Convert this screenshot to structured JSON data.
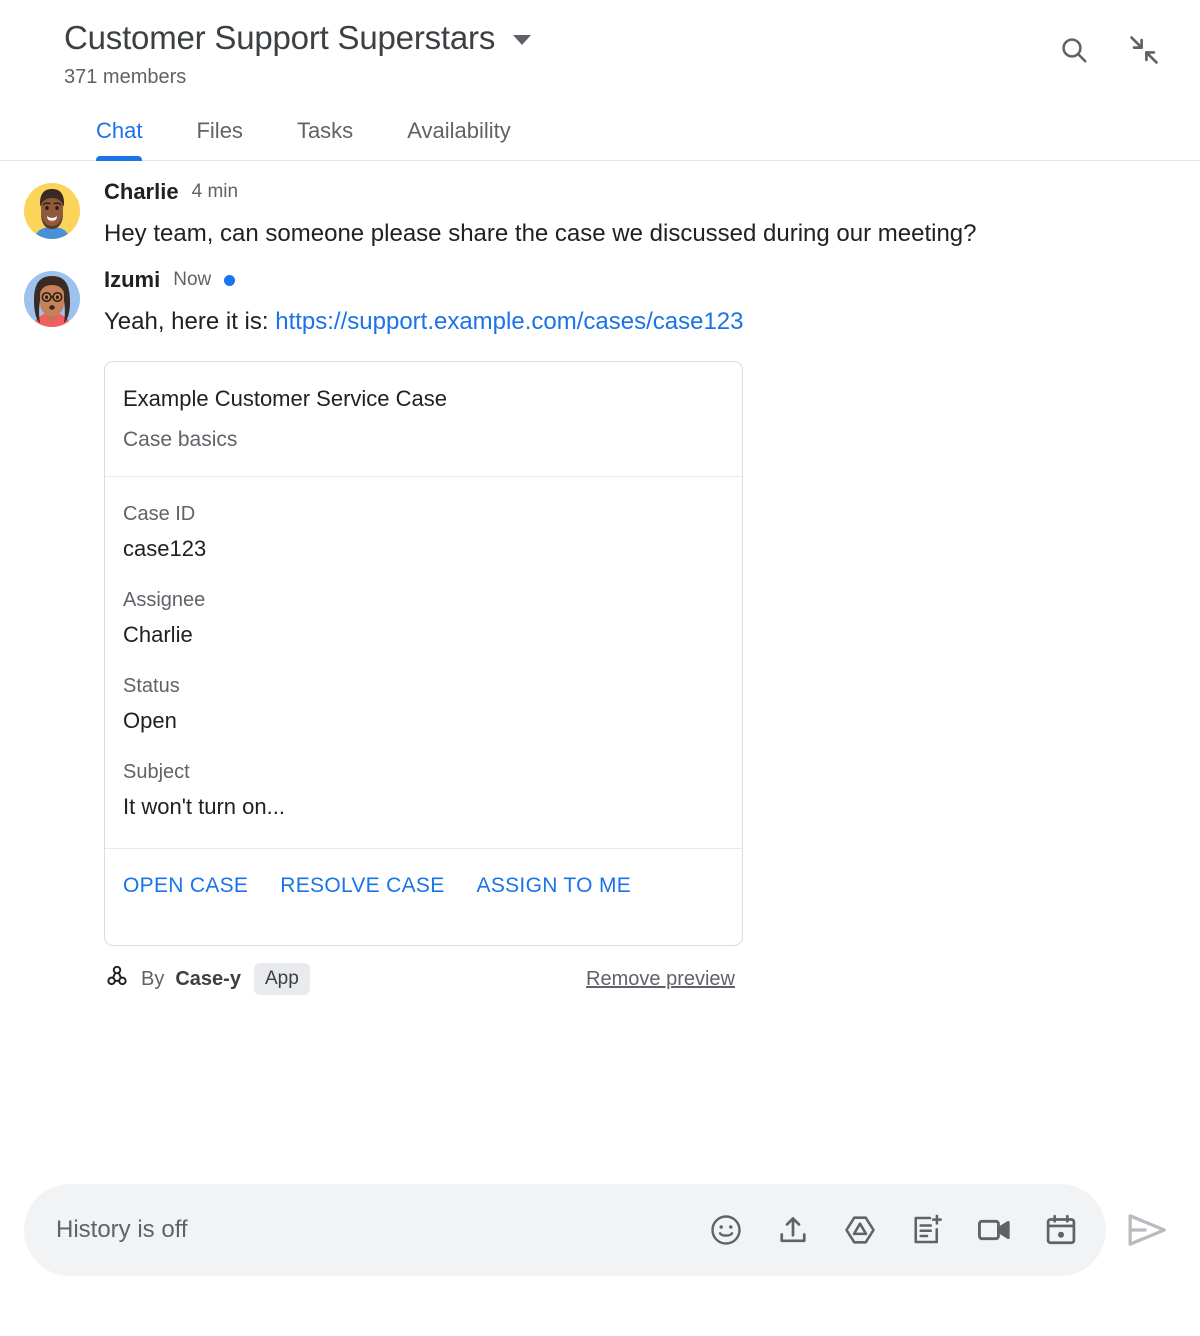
{
  "header": {
    "room_title": "Customer Support Superstars",
    "members": "371 members",
    "dropdown_icon": "chevron-down-icon",
    "actions": [
      {
        "name": "search-icon",
        "label": "Search"
      },
      {
        "name": "collapse-icon",
        "label": "Collapse"
      }
    ]
  },
  "tabs": [
    {
      "label": "Chat",
      "active": true
    },
    {
      "label": "Files",
      "active": false
    },
    {
      "label": "Tasks",
      "active": false
    },
    {
      "label": "Availability",
      "active": false
    }
  ],
  "messages": [
    {
      "sender": "Charlie",
      "time": "4 min",
      "unread": false,
      "text": "Hey team, can someone please share the case we discussed during our meeting?"
    },
    {
      "sender": "Izumi",
      "time": "Now",
      "unread": true,
      "text_prefix": "Yeah, here it is: ",
      "link_text": "https://support.example.com/cases/case123"
    }
  ],
  "card": {
    "title": "Example Customer Service Case",
    "subtitle": "Case basics",
    "fields": [
      {
        "label": "Case ID",
        "value": "case123"
      },
      {
        "label": "Assignee",
        "value": "Charlie"
      },
      {
        "label": "Status",
        "value": "Open"
      },
      {
        "label": "Subject",
        "value": "It won't turn on..."
      }
    ],
    "actions": [
      {
        "label": "OPEN CASE"
      },
      {
        "label": "RESOLVE CASE"
      },
      {
        "label": "ASSIGN TO ME"
      }
    ]
  },
  "attribution": {
    "app_icon": "webhook-icon",
    "by_text": "By",
    "app_name": "Case-y",
    "badge": "App",
    "remove_preview": "Remove preview"
  },
  "composer": {
    "placeholder": "History is off",
    "icons": [
      {
        "name": "emoji-icon",
        "label": "Insert emoji"
      },
      {
        "name": "upload-icon",
        "label": "Upload file"
      },
      {
        "name": "google-drive-icon",
        "label": "Add from Drive"
      },
      {
        "name": "create-task-icon",
        "label": "Create a task"
      },
      {
        "name": "video-camera-icon",
        "label": "Start a video meeting"
      },
      {
        "name": "calendar-icon",
        "label": "Schedule an event"
      }
    ],
    "send_label": "Send"
  },
  "colors": {
    "accent": "#1a73e8",
    "text_primary": "#202124",
    "text_secondary": "#5f6368",
    "border": "#dadce0",
    "composer_bg": "#f1f3f4",
    "badge_bg": "#e8eaed"
  }
}
